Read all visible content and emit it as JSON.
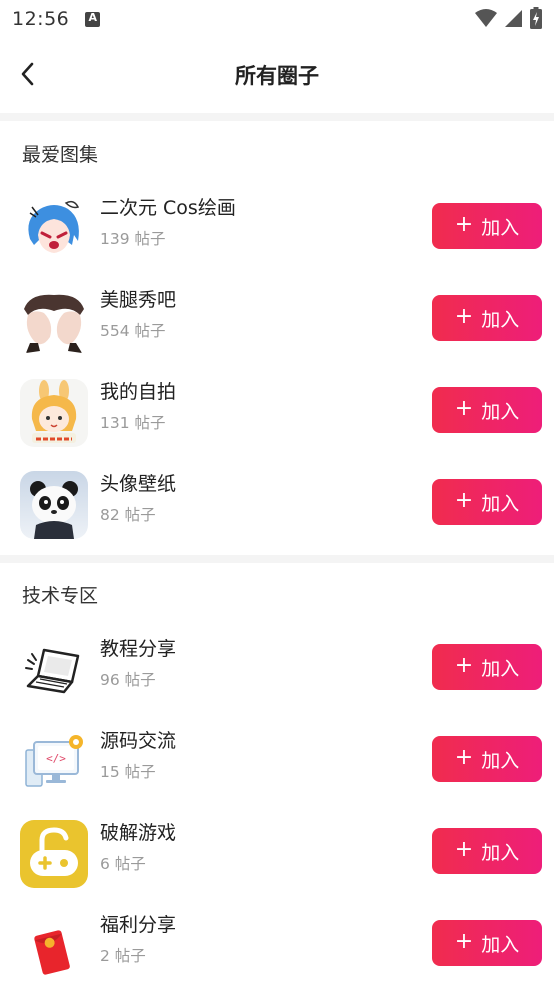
{
  "status": {
    "time": "12:56"
  },
  "header": {
    "title": "所有圈子",
    "back_icon": "chevron-left-icon"
  },
  "join_button": {
    "plus": "+",
    "label": "加入"
  },
  "sections": [
    {
      "title": "最爱图集",
      "items": [
        {
          "name": "二次元 Cos绘画",
          "count": "139 帖子",
          "icon": "anime-girl-avatar"
        },
        {
          "name": "美腿秀吧",
          "count": "554 帖子",
          "icon": "legs-photo-avatar"
        },
        {
          "name": "我的自拍",
          "count": "131 帖子",
          "icon": "cartoon-bunny-girl-avatar"
        },
        {
          "name": "头像壁纸",
          "count": "82 帖子",
          "icon": "panda-avatar"
        }
      ]
    },
    {
      "title": "技术专区",
      "items": [
        {
          "name": "教程分享",
          "count": "96 帖子",
          "icon": "laptop-icon"
        },
        {
          "name": "源码交流",
          "count": "15 帖子",
          "icon": "code-monitor-icon"
        },
        {
          "name": "破解游戏",
          "count": "6 帖子",
          "icon": "gamepad-unlock-icon"
        },
        {
          "name": "福利分享",
          "count": "2 帖子",
          "icon": "red-envelope-icon"
        }
      ]
    }
  ],
  "colors": {
    "accent_start": "#f02c4e",
    "accent_end": "#ee1e79",
    "count_text": "#9a9a9a",
    "divider": "#f4f4f4"
  }
}
